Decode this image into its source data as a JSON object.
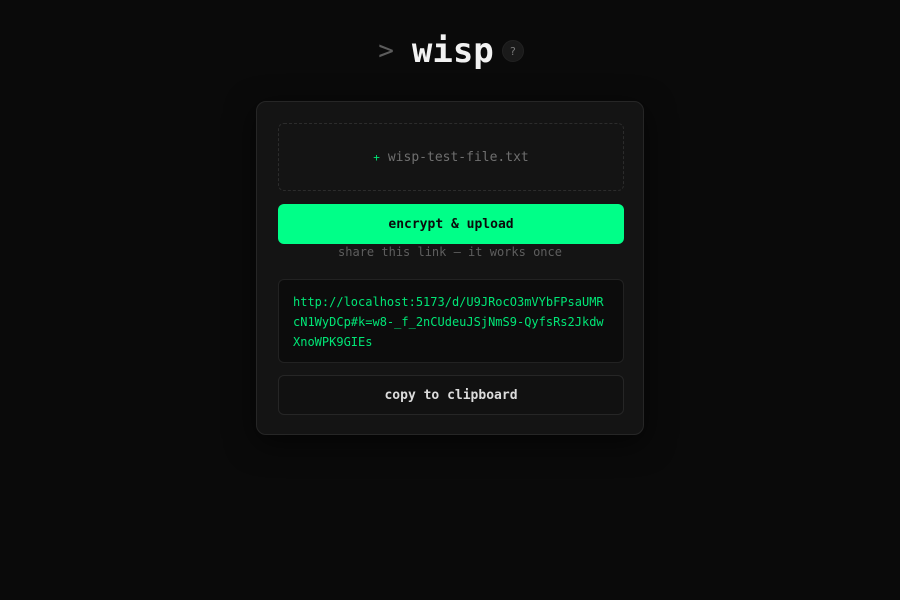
{
  "header": {
    "prompt_glyph": ">",
    "title": "wisp",
    "help_label": "?"
  },
  "dropzone": {
    "plus_glyph": "+",
    "file_name": "wisp-test-file.txt"
  },
  "upload_button": {
    "label": "encrypt & upload"
  },
  "share_hint": "share this link — it works once",
  "share_link": "http://localhost:5173/d/U9JRocO3mVYbFPsaUMRcN1WyDCp#k=w8-_f_2nCUdeuJSjNmS9-QyfsRs2JkdwXnoWPK9GIEs",
  "copy_button": {
    "label": "copy to clipboard"
  },
  "colors": {
    "background": "#0a0a0a",
    "accent": "#00ff88",
    "link_text": "#00e676",
    "card": "#141414"
  }
}
